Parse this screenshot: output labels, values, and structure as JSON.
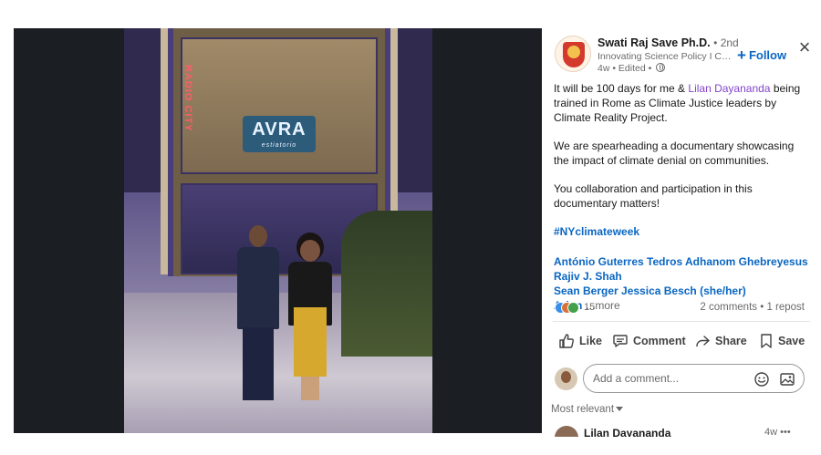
{
  "photo": {
    "neon_text": "RADIO CITY",
    "sign_title": "AVRA",
    "sign_subtitle": "estiatorio"
  },
  "author": {
    "name": "Swati Raj Save Ph.D.",
    "degree": "• 2nd",
    "headline": "Innovating Science Policy I Conquering Climate",
    "time": "4w • Edited •",
    "follow_label": "Follow"
  },
  "post": {
    "line1_prefix": "It will be 100 days for me & ",
    "line1_mention": "Lilan Dayananda",
    "line1_suffix": " being trained in Rome as Climate Justice leaders by Climate Reality Project.",
    "para2": "We are spearheading a documentary showcasing the impact of climate denial on communities.",
    "para3": "You collaboration and participation in this documentary matters!",
    "hashtag": "#NYclimateweek",
    "tags_line1": "António Guterres Tedros Adhanom Ghebreyesus Rajiv J. Shah",
    "tags_line2": "Sean Berger Jessica Besch (she/her) Arjun",
    "more": "...more"
  },
  "social": {
    "reaction_count": "15",
    "counts": "2 comments • 1 repost"
  },
  "actions": {
    "like": "Like",
    "comment": "Comment",
    "share": "Share",
    "save": "Save"
  },
  "comment_box": {
    "placeholder": "Add a comment..."
  },
  "sort_label": "Most relevant",
  "first_comment": {
    "name": "Lilan Dayananda",
    "time": "4w •••"
  },
  "colors": {
    "link_blue": "#0a66c2",
    "mention_purple": "#8344cc",
    "viewer_bg": "#1b1f23"
  }
}
